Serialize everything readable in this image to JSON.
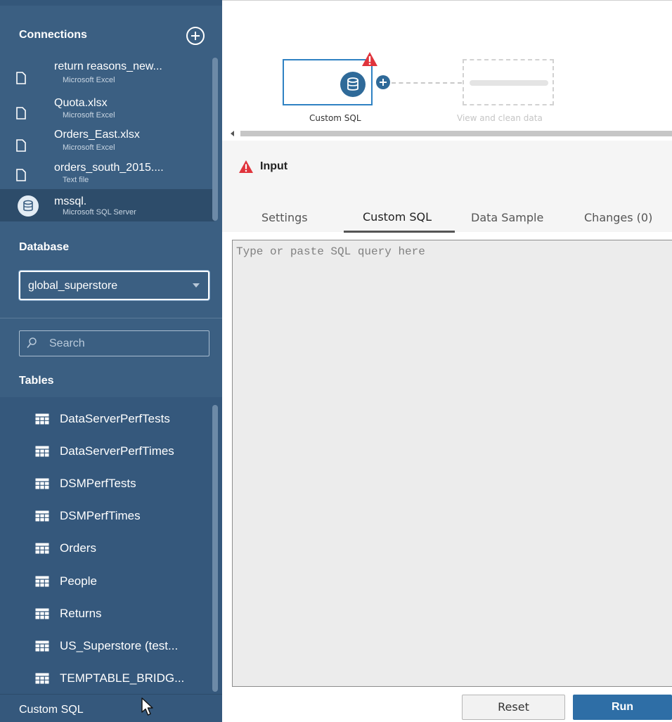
{
  "sidebar": {
    "connections_title": "Connections",
    "connections": [
      {
        "name": "return reasons_new...",
        "type": "Microsoft Excel",
        "icon": "file-icon"
      },
      {
        "name": "Quota.xlsx",
        "type": "Microsoft Excel",
        "icon": "file-icon"
      },
      {
        "name": "Orders_East.xlsx",
        "type": "Microsoft Excel",
        "icon": "file-icon"
      },
      {
        "name": "orders_south_2015....",
        "type": "Text file",
        "icon": "file-icon"
      },
      {
        "name": "mssql.",
        "type": "Microsoft SQL Server",
        "icon": "database-icon",
        "selected": true
      }
    ],
    "database_title": "Database",
    "database_value": "global_superstore",
    "search_placeholder": "Search",
    "tables_title": "Tables",
    "tables": [
      "DataServerPerfTests",
      "DataServerPerfTimes",
      "DSMPerfTests",
      "DSMPerfTimes",
      "Orders",
      "People",
      "Returns",
      "US_Superstore (test...",
      "TEMPTABLE_BRIDG..."
    ],
    "custom_sql_link": "Custom SQL"
  },
  "flow": {
    "node_label": "Custom SQL",
    "ghost_label": "View and clean data"
  },
  "panel": {
    "title": "Input",
    "tabs": [
      "Settings",
      "Custom SQL",
      "Data Sample",
      "Changes (0)"
    ],
    "active_tab": "Custom SQL",
    "editor_placeholder": "Type or paste SQL query here",
    "reset_label": "Reset",
    "run_label": "Run"
  },
  "colors": {
    "sidebar_bg": "#3b5f82",
    "accent_blue": "#2e6ea6",
    "warning_red": "#e0343c"
  }
}
